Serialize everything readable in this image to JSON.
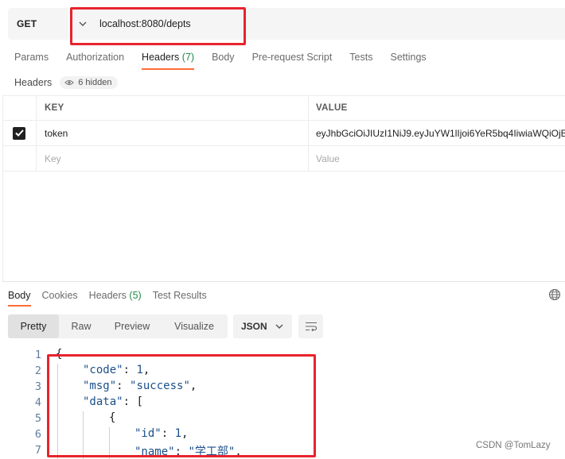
{
  "request": {
    "method": "GET",
    "url": "localhost:8080/depts"
  },
  "request_tabs": [
    {
      "label": "Params",
      "count": ""
    },
    {
      "label": "Authorization",
      "count": ""
    },
    {
      "label": "Headers",
      "count": "(7)"
    },
    {
      "label": "Body",
      "count": ""
    },
    {
      "label": "Pre-request Script",
      "count": ""
    },
    {
      "label": "Tests",
      "count": ""
    },
    {
      "label": "Settings",
      "count": ""
    }
  ],
  "headers_section": {
    "label": "Headers",
    "hidden_badge": "6 hidden"
  },
  "headers_table": {
    "col_key": "KEY",
    "col_value": "VALUE",
    "rows": [
      {
        "key": "token",
        "value": "eyJhbGciOiJIUzI1NiJ9.eyJuYW1lIjoi6YeR5bq4IiwiaWQiOjE"
      }
    ],
    "key_placeholder": "Key",
    "value_placeholder": "Value"
  },
  "response_tabs": [
    {
      "label": "Body",
      "count": ""
    },
    {
      "label": "Cookies",
      "count": ""
    },
    {
      "label": "Headers",
      "count": "(5)"
    },
    {
      "label": "Test Results",
      "count": ""
    }
  ],
  "view_modes": [
    "Pretty",
    "Raw",
    "Preview",
    "Visualize"
  ],
  "format_select": "JSON",
  "code_lines": {
    "numbers": [
      "1",
      "2",
      "3",
      "4",
      "5",
      "6",
      "7"
    ],
    "l1": "{",
    "l2_key": "\"code\"",
    "l2_val": "1",
    "l3_key": "\"msg\"",
    "l3_val": "\"success\"",
    "l4_key": "\"data\"",
    "l4_val": "[",
    "l5": "{",
    "l6_key": "\"id\"",
    "l6_val": "1",
    "l7_key": "\"name\"",
    "l7_val": "\"学工部\""
  },
  "watermark": "CSDN @TomLazy",
  "colors": {
    "accent_tab": "#ff6c37",
    "highlight_box": "#e8232e",
    "count_green": "#1f8a4c"
  }
}
